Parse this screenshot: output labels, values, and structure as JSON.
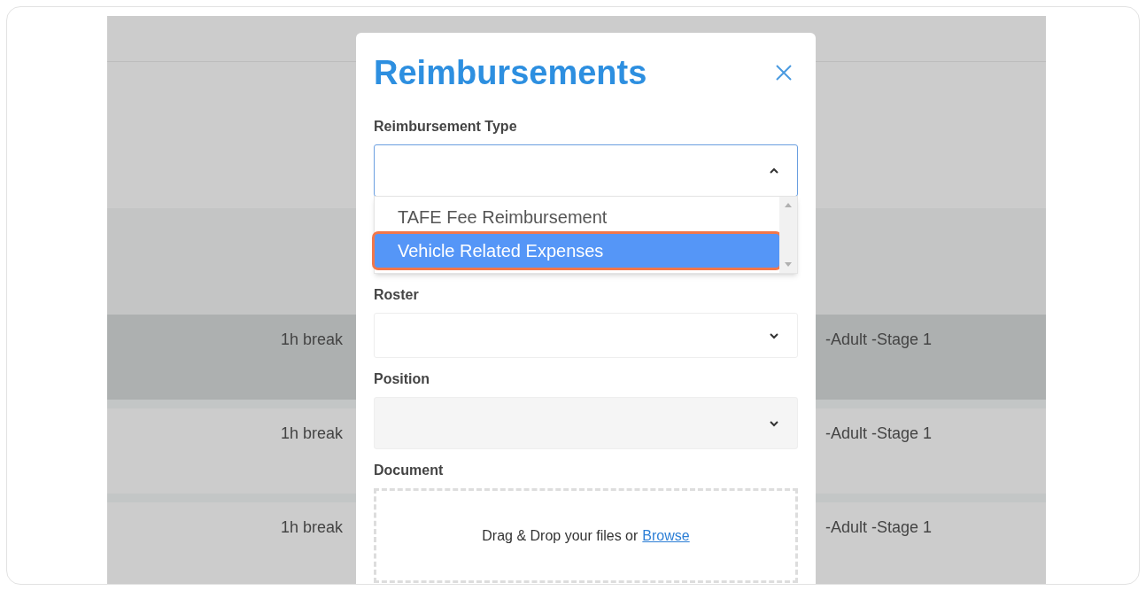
{
  "modal": {
    "title": "Reimbursements",
    "fields": [
      {
        "kind": "select",
        "label": "Reimbursement Type",
        "expanded": true,
        "disabled": false,
        "options": [
          {
            "label": "TAFE Fee Reimbursement",
            "selected": false
          },
          {
            "label": "Vehicle Related Expenses",
            "selected": true
          }
        ]
      },
      {
        "kind": "select",
        "label": "Roster",
        "expanded": false,
        "disabled": false
      },
      {
        "kind": "select",
        "label": "Position",
        "expanded": false,
        "disabled": true
      },
      {
        "kind": "upload",
        "label": "Document",
        "prompt": "Drag & Drop your files or",
        "link": "Browse"
      }
    ]
  },
  "background_rows": [
    {
      "column_1": "1h break",
      "column_2": "-Adult -Stage 1",
      "selected": true
    },
    {
      "column_1": "1h break",
      "column_2": "-Adult -Stage 1",
      "selected": false
    },
    {
      "column_1": "1h break",
      "column_2": "-Adult -Stage 1",
      "selected": false
    }
  ]
}
